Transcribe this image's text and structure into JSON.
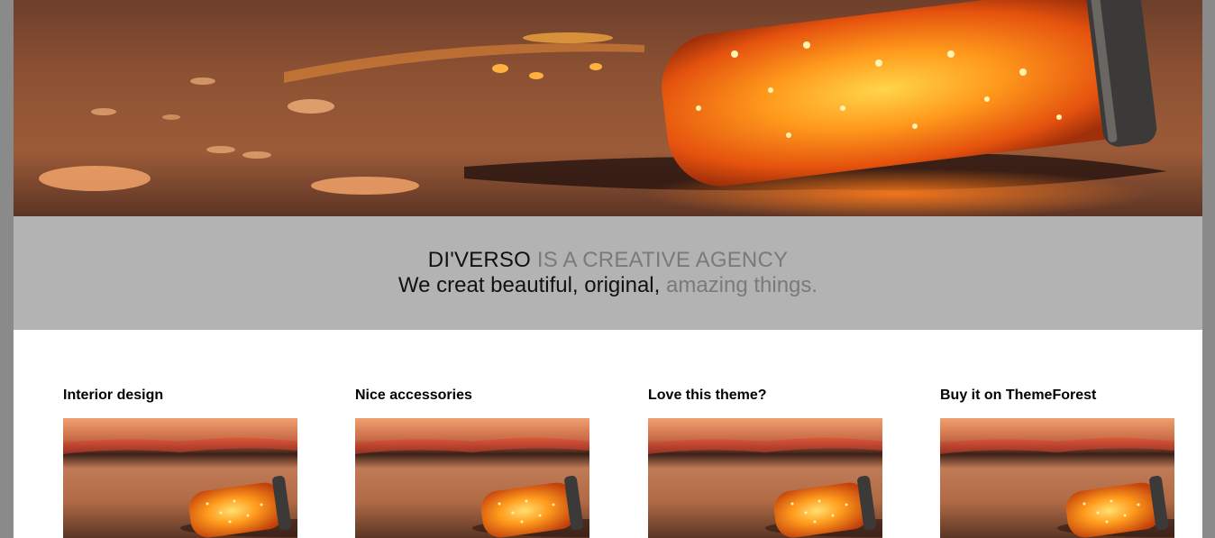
{
  "hero": {
    "image_subject": "glowing mason jar with string lights lying on wet sand at sunset"
  },
  "tagline": {
    "brand": "DI'VERSO",
    "brand_rest": " IS A CREATIVE AGENCY",
    "line2_main": "We creat beautiful, original,",
    "line2_rest": " amazing things."
  },
  "features": [
    {
      "title": "Interior design"
    },
    {
      "title": "Nice accessories"
    },
    {
      "title": "Love this theme?"
    },
    {
      "title": "Buy it on ThemeForest"
    }
  ],
  "colors": {
    "frame": "#8a8a8a",
    "band": "#b3b3b3",
    "muted_text": "#7a7a7a",
    "glow": "#ff8a1a"
  }
}
